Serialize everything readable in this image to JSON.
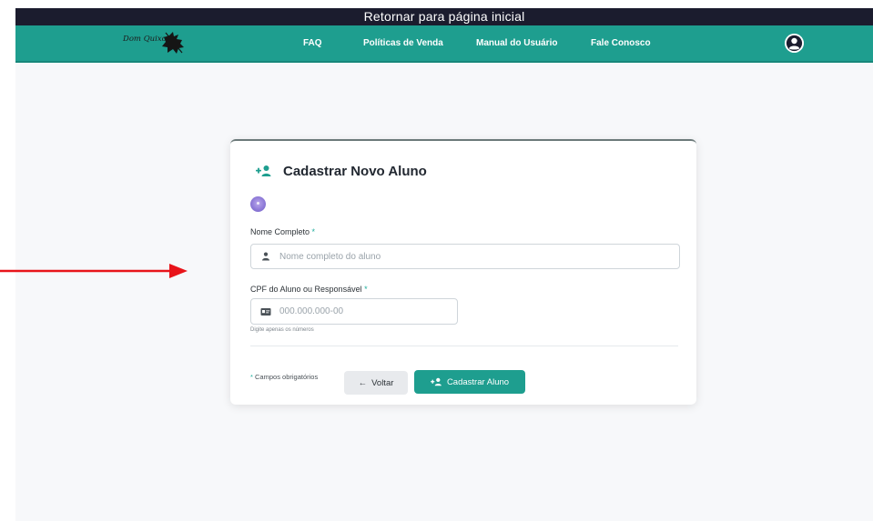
{
  "top_banner": {
    "text": "Retornar para página inicial"
  },
  "nav": {
    "logo_text": "Dom Quixote",
    "links": [
      {
        "label": "FAQ"
      },
      {
        "label": "Políticas de Venda"
      },
      {
        "label": "Manual do Usuário"
      },
      {
        "label": "Fale Conosco"
      }
    ],
    "avatar_icon": "user-circle-icon"
  },
  "form": {
    "title": "Cadastrar Novo Aluno",
    "title_icon": "user-plus-icon",
    "avatar_icon": "avatar-icon",
    "name_field": {
      "label": "Nome Completo",
      "required_mark": "*",
      "placeholder": "Nome completo do aluno",
      "value": "",
      "icon": "user-icon"
    },
    "cpf_field": {
      "label": "CPF do Aluno ou Responsável",
      "required_mark": "*",
      "placeholder": "000.000.000-00",
      "value": "",
      "icon": "id-card-icon",
      "hint": "Digite apenas os números"
    },
    "footer_note": {
      "mark": "*",
      "text": "Campos obrigatórios"
    },
    "back_button": {
      "arrow": "←",
      "label": "Voltar"
    },
    "submit_button": {
      "icon": "user-plus-icon",
      "label": "Cadastrar Aluno"
    }
  },
  "colors": {
    "teal": "#1e9e8f",
    "dark_bar": "#1b1c2e",
    "page_bg": "#f7f8fa",
    "annotation_arrow": "#e8141a"
  }
}
